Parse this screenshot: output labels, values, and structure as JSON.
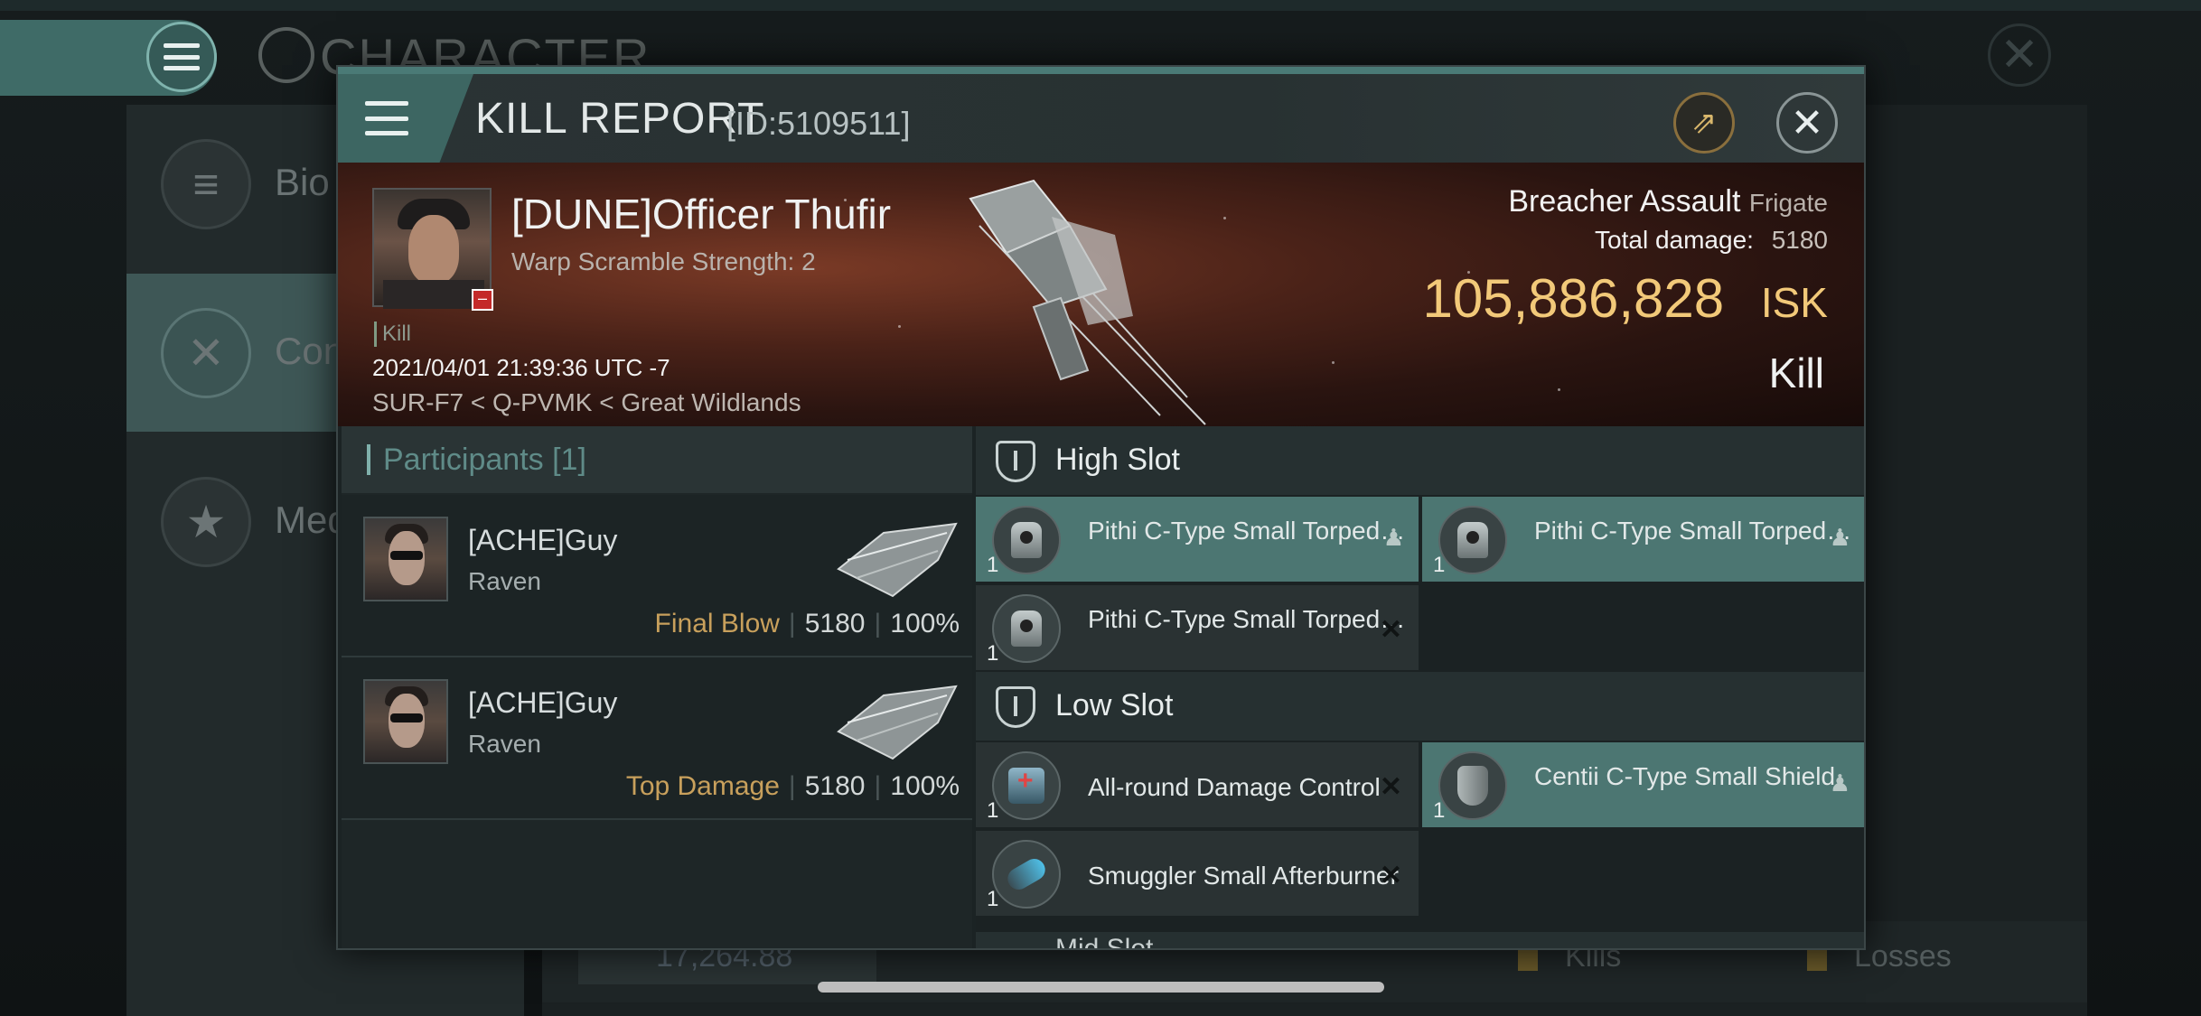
{
  "background": {
    "title": "CHARACTER",
    "menu_items": [
      {
        "label": "Bio",
        "icon": "list-icon"
      },
      {
        "label": "Con",
        "icon": "crossed-swords-icon"
      },
      {
        "label": "Med",
        "icon": "star-icon"
      }
    ],
    "balance": "17,264.88",
    "kills_label": "Kills",
    "losses_label": "Losses"
  },
  "modal": {
    "title": "KILL REPORT",
    "report_id": "[ID:5109511]",
    "share_icon": "external-link-icon",
    "close_icon": "close-icon"
  },
  "victim": {
    "name": "[DUNE]Officer Thufir",
    "warp_scramble": "Warp Scramble Strength: 2",
    "kill_tag": "Kill",
    "timestamp": "2021/04/01 21:39:36 UTC -7",
    "location": "SUR-F7 < Q-PVMK < Great Wildlands"
  },
  "ship": {
    "name": "Breacher Assault",
    "class": "Frigate",
    "total_damage_label": "Total damage:",
    "total_damage": "5180",
    "isk_value": "105,886,828",
    "isk_unit": "ISK",
    "result": "Kill"
  },
  "participants": {
    "header": "Participants [1]",
    "rows": [
      {
        "name": "[ACHE]Guy",
        "ship": "Raven",
        "tag": "Final Blow",
        "damage": "5180",
        "percent": "100%"
      },
      {
        "name": "[ACHE]Guy",
        "ship": "Raven",
        "tag": "Top Damage",
        "damage": "5180",
        "percent": "100%"
      }
    ]
  },
  "fitting": {
    "high_slot_label": "High Slot",
    "high_slots": [
      {
        "name": "Pithi C-Type Small Torpedo ...",
        "qty": "1",
        "status": "dropped"
      },
      {
        "name": "Pithi C-Type Small Torpedo ...",
        "qty": "1",
        "status": "dropped"
      },
      {
        "name": "Pithi C-Type Small Torpedo ...",
        "qty": "1",
        "status": "destroyed"
      }
    ],
    "low_slot_label": "Low Slot",
    "low_slots": [
      {
        "name": "All-round Damage Control",
        "qty": "1",
        "status": "destroyed"
      },
      {
        "name": "Centii C-Type Small Shield",
        "qty": "1",
        "status": "dropped"
      },
      {
        "name": "Smuggler Small Afterburner",
        "qty": "1",
        "status": "destroyed"
      }
    ],
    "mid_slot_label": "Mid Slot"
  }
}
